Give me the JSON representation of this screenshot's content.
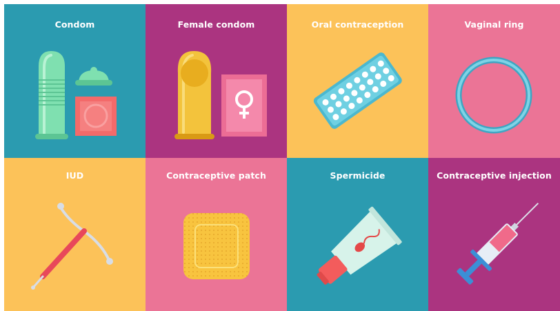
{
  "tiles": [
    {
      "label": "Condom",
      "icon": "condom-icon",
      "color": "#2b9bb0"
    },
    {
      "label": "Female condom",
      "icon": "female-condom-icon",
      "color": "#ab3480"
    },
    {
      "label": "Oral contraception",
      "icon": "pill-blister-icon",
      "color": "#fcc259"
    },
    {
      "label": "Vaginal ring",
      "icon": "vaginal-ring-icon",
      "color": "#eb7496"
    },
    {
      "label": "IUD",
      "icon": "iud-icon",
      "color": "#fcc259"
    },
    {
      "label": "Contraceptive patch",
      "icon": "patch-icon",
      "color": "#eb7496"
    },
    {
      "label": "Spermicide",
      "icon": "spermicide-tube-icon",
      "color": "#2b9bb0"
    },
    {
      "label": "Contraceptive injection",
      "icon": "syringe-icon",
      "color": "#ab3480"
    }
  ]
}
